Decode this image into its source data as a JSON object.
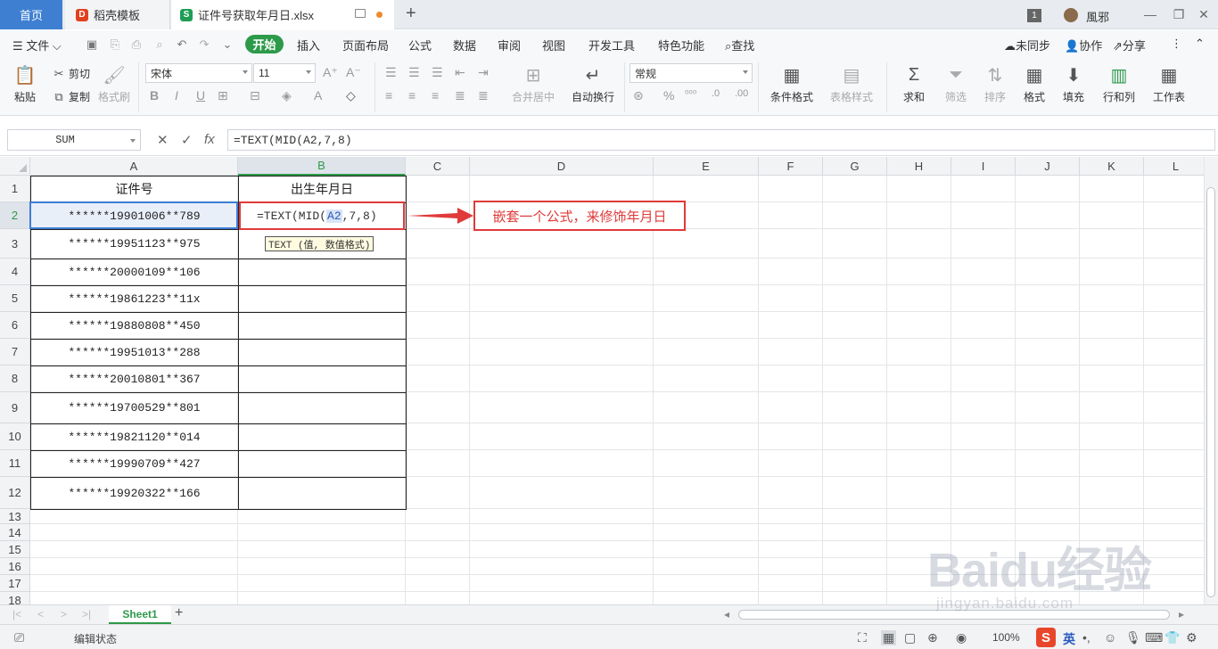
{
  "tabs": {
    "home": "首页",
    "template": "稻壳模板",
    "file": "证件号获取年月日.xlsx"
  },
  "window": {
    "badge": "1",
    "user": "風邪"
  },
  "menu": {
    "file": "文件",
    "items": [
      "开始",
      "插入",
      "页面布局",
      "公式",
      "数据",
      "审阅",
      "视图",
      "开发工具",
      "特色功能",
      "查找"
    ],
    "right": [
      "未同步",
      "协作",
      "分享"
    ]
  },
  "ribbon": {
    "paste": "粘贴",
    "cut": "剪切",
    "copy": "复制",
    "format_painter": "格式刷",
    "font_name": "宋体",
    "font_size": "11",
    "number_format": "常规",
    "merge": "合并居中",
    "wrap": "自动换行",
    "cond_format": "条件格式",
    "table_style": "表格样式",
    "sum": "求和",
    "filter": "筛选",
    "sort": "排序",
    "format": "格式",
    "fill": "填充",
    "rowcol": "行和列",
    "worksheet": "工作表"
  },
  "formula_bar": {
    "name_box": "SUM",
    "fx": "fx",
    "formula": "=TEXT(MID(A2,7,8)"
  },
  "columns": [
    "A",
    "B",
    "C",
    "D",
    "E",
    "F",
    "G",
    "H",
    "I",
    "J",
    "K",
    "L"
  ],
  "rows": [
    "1",
    "2",
    "3",
    "4",
    "5",
    "6",
    "7",
    "8",
    "9",
    "10",
    "11",
    "12",
    "13",
    "14",
    "15",
    "16",
    "17",
    "18"
  ],
  "sheet": {
    "header_a": "证件号",
    "header_b": "出生年月日",
    "ids": [
      "******19901006**789",
      "******19951123**975",
      "******20000109**106",
      "******19861223**11x",
      "******19880808**450",
      "******19951013**288",
      "******20010801**367",
      "******19700529**801",
      "******19821120**014",
      "******19990709**427",
      "******19920322**166"
    ],
    "edit_formula_pre": "=TEXT(MID(",
    "edit_formula_ref": "A2",
    "edit_formula_post": ",7,8)",
    "tooltip": "TEXT (值, 数值格式)",
    "callout": "嵌套一个公式，来修饰年月日"
  },
  "sheet_tab": "Sheet1",
  "status": {
    "mode": "编辑状态",
    "zoom": "100%",
    "ime": "英"
  },
  "watermark": {
    "main": "Baidu经验",
    "sub": "jingyan.baidu.com"
  },
  "colors": {
    "accent_green": "#2d9a4a",
    "home_tab": "#3e7fd1",
    "annotation_red": "#e03a3a",
    "selection_blue": "#3d7dd6"
  }
}
